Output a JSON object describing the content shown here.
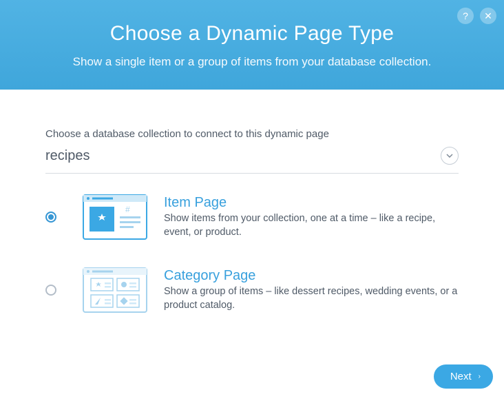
{
  "header": {
    "title": "Choose a Dynamic Page Type",
    "subtitle": "Show a single item or a group of items from your database collection."
  },
  "main": {
    "collection_label": "Choose a database collection to connect to this dynamic page",
    "collection_value": "recipes",
    "options": [
      {
        "title": "Item Page",
        "desc": "Show items from your collection, one at a time – like a recipe, event, or product.",
        "selected": true
      },
      {
        "title": "Category Page",
        "desc": "Show a group of items – like dessert recipes, wedding events, or a product catalog.",
        "selected": false
      }
    ]
  },
  "footer": {
    "next_label": "Next"
  },
  "icons": {
    "help": "?",
    "close": "✕",
    "chevron_down": "⌄",
    "arrow_right": "›"
  }
}
